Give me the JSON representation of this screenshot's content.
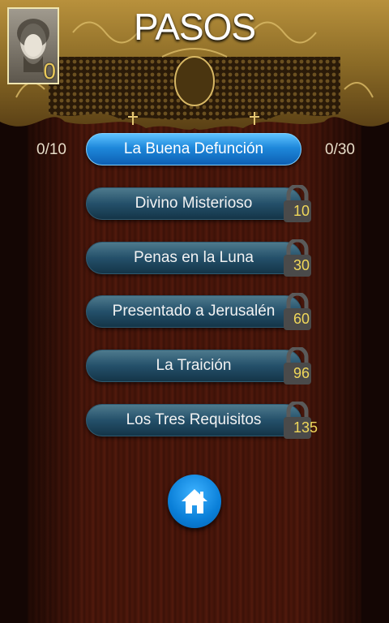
{
  "header": {
    "title": "PASOS",
    "portrait_count": "0"
  },
  "scores": {
    "left": "0/10",
    "right": "0/30"
  },
  "levels": [
    {
      "label": "La Buena Defunción",
      "state": "active",
      "cost": ""
    },
    {
      "label": "Divino Misterioso",
      "state": "locked",
      "cost": "10"
    },
    {
      "label": "Penas en la Luna",
      "state": "locked",
      "cost": "30"
    },
    {
      "label": "Presentado a Jerusalén",
      "state": "locked",
      "cost": "60"
    },
    {
      "label": "La Traición",
      "state": "locked",
      "cost": "96"
    },
    {
      "label": "Los Tres Requisitos",
      "state": "locked",
      "cost": "135"
    }
  ],
  "icons": {
    "home": "home-icon",
    "lock": "lock-icon"
  },
  "colors": {
    "active_button": "#1e88db",
    "locked_button": "#24506a",
    "gold": "#c8a24a",
    "cost_text": "#f0d75a"
  }
}
